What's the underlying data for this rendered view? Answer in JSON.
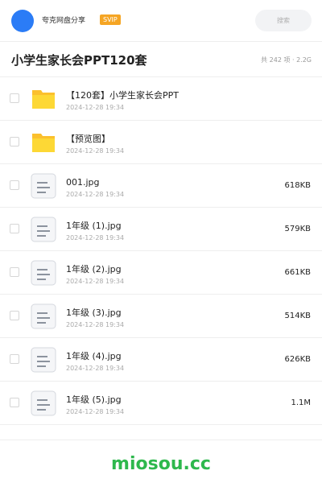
{
  "header": {
    "app_name": "夸克网盘分享",
    "badge": "SVIP",
    "search_placeholder": "搜索"
  },
  "title": {
    "text": "小学生家长会PPT120套",
    "meta": "共 242 项 · 2.2G"
  },
  "files": [
    {
      "name": "【120套】小学生家长会PPT",
      "date": "2024-12-28 19:34",
      "size": "",
      "icon": "folder-icon"
    },
    {
      "name": "【预览图】",
      "date": "2024-12-28 19:34",
      "size": "",
      "icon": "folder-icon"
    },
    {
      "name": "001.jpg",
      "date": "2024-12-28 19:34",
      "size": "618KB",
      "icon": "file-icon"
    },
    {
      "name": "1年级 (1).jpg",
      "date": "2024-12-28 19:34",
      "size": "579KB",
      "icon": "file-icon"
    },
    {
      "name": "1年级 (2).jpg",
      "date": "2024-12-28 19:34",
      "size": "661KB",
      "icon": "file-icon"
    },
    {
      "name": "1年级 (3).jpg",
      "date": "2024-12-28 19:34",
      "size": "514KB",
      "icon": "file-icon"
    },
    {
      "name": "1年级 (4).jpg",
      "date": "2024-12-28 19:34",
      "size": "626KB",
      "icon": "file-icon"
    },
    {
      "name": "1年级 (5).jpg",
      "date": "2024-12-28 19:34",
      "size": "1.1M",
      "icon": "file-icon"
    }
  ],
  "footer": {
    "watermark": "miosou.cc"
  },
  "colors": {
    "avatar": "#2b7cf6",
    "badge": "#f5a524",
    "folder": "#fbc02d",
    "watermark": "#2eb84d"
  }
}
